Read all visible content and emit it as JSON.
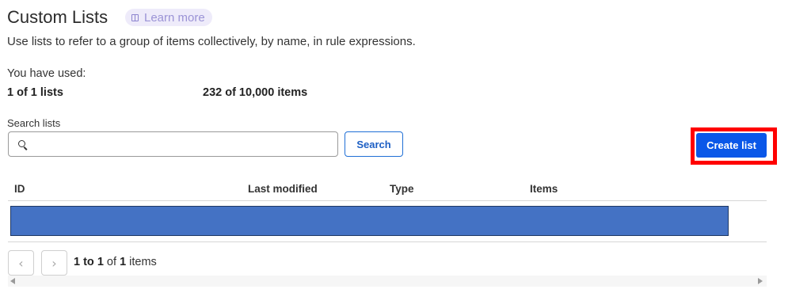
{
  "header": {
    "title": "Custom Lists",
    "learn_more": "Learn more",
    "subtitle": "Use lists to refer to a group of items collectively, by name, in rule expressions."
  },
  "usage": {
    "label": "You have used:",
    "lists": "1 of 1 lists",
    "items": "232 of 10,000 items"
  },
  "search": {
    "label": "Search lists",
    "value": "",
    "placeholder": "",
    "button_label": "Search"
  },
  "actions": {
    "create_label": "Create list"
  },
  "table": {
    "columns": [
      "ID",
      "Last modified",
      "Type",
      "Items"
    ],
    "rows": []
  },
  "pagination": {
    "range_start": "1",
    "range_sep": " to ",
    "range_end": "1",
    "of_word": " of ",
    "total": "1",
    "unit": " items"
  },
  "colors": {
    "accent": "#0a57e8",
    "highlight": "#ff0000",
    "redaction": "#4472c4"
  },
  "icons": [
    "book-icon",
    "search-icon",
    "chevron-left-icon",
    "chevron-right-icon",
    "scroll-left-icon",
    "scroll-right-icon"
  ]
}
